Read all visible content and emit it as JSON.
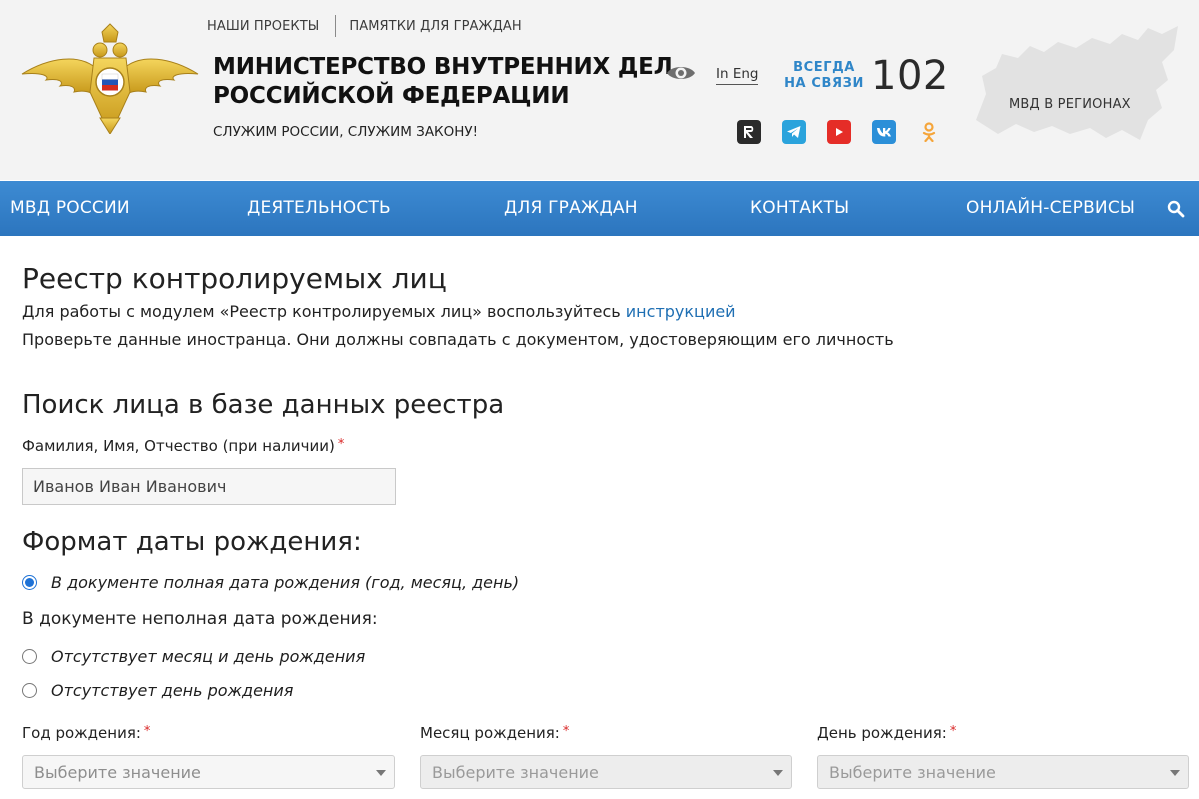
{
  "header": {
    "top_links": [
      "НАШИ ПРОЕКТЫ",
      "ПАМЯТКИ ДЛЯ ГРАЖДАН"
    ],
    "org_title_line1": "МИНИСТЕРСТВО ВНУТРЕННИХ ДЕЛ",
    "org_title_line2": "РОССИЙСКОЙ ФЕДЕРАЦИИ",
    "motto": "СЛУЖИМ РОССИИ, СЛУЖИМ ЗАКОНУ!",
    "accessibility_icon": "eye-icon",
    "language_link": "In Eng",
    "hotline_caption_line1": "ВСЕГДА",
    "hotline_caption_line2": "НА СВЯЗИ",
    "hotline_number": "102",
    "socials": [
      {
        "name": "rutube-icon",
        "color": "#2b2b2b"
      },
      {
        "name": "telegram-icon",
        "color": "#2aa3dc"
      },
      {
        "name": "youtube-icon",
        "color": "#e52d27"
      },
      {
        "name": "vk-icon",
        "color": "#2b8fd8"
      },
      {
        "name": "odnoklassniki-icon",
        "color": "#f5a53a"
      }
    ],
    "regions_label": "МВД В РЕГИОНАХ"
  },
  "nav": {
    "items": [
      "МВД РОССИИ",
      "ДЕЯТЕЛЬНОСТЬ",
      "ДЛЯ ГРАЖДАН",
      "КОНТАКТЫ",
      "ОНЛАЙН-СЕРВИСЫ"
    ],
    "search_icon": "search-icon",
    "color": "#3584cc"
  },
  "content": {
    "page_title": "Реестр контролируемых лиц",
    "intro_prefix": "Для работы с модулем «Реестр контролируемых лиц» воспользуйтесь",
    "intro_link": "инструкцией",
    "intro_line2": "Проверьте данные иностранца. Они должны совпадать с документом, удостоверяющим его личность",
    "search_title": "Поиск лица в базе данных реестра",
    "name_label": "Фамилия, Имя, Отчество (при наличии)",
    "required_mark": "*",
    "name_value": "Иванов Иван Иванович",
    "date_format_title": "Формат даты рождения:",
    "radio_full": "В документе полная дата рождения (год, месяц, день)",
    "partial_label": "В документе неполная дата рождения:",
    "radio_no_month_day": "Отсутствует месяц и день рождения",
    "radio_no_day": "Отсутствует день рождения",
    "year_label": "Год рождения:",
    "month_label": "Месяц рождения:",
    "day_label": "День рождения:",
    "select_placeholder": "Выберите значение",
    "accent_color": "#1e72d6"
  }
}
